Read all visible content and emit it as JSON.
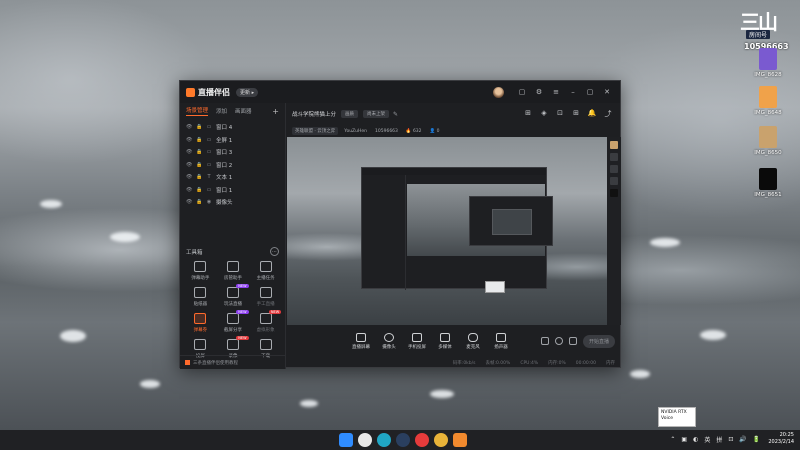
{
  "desktop": {
    "brand": {
      "logo_text": "三山",
      "tag": "房间号",
      "room_number": "10596663"
    },
    "icons": [
      {
        "label": "IMG_8628",
        "color": "#7a5ad0"
      },
      {
        "label": "IMG_8648",
        "color": "#f0a24a"
      },
      {
        "label": "IMG_8650",
        "color": "#c9a26d"
      },
      {
        "label": "IMG_8651",
        "color": "#0a0a0a"
      }
    ]
  },
  "app": {
    "name": "直播伴侣",
    "version_pill": "更新 ▸",
    "left_tabs": [
      {
        "label": "场景管理",
        "active": true
      },
      {
        "label": "添加",
        "active": false
      },
      {
        "label": "画面器",
        "active": false
      }
    ],
    "tab_add": "+",
    "scenes": [
      {
        "icon": "▭",
        "label": "窗口 4"
      },
      {
        "icon": "▭",
        "label": "全屏 1"
      },
      {
        "icon": "▭",
        "label": "窗口 3"
      },
      {
        "icon": "▭",
        "label": "窗口 2"
      },
      {
        "icon": "T",
        "label": "文本 1"
      },
      {
        "icon": "▭",
        "label": "窗口 1"
      },
      {
        "icon": "◉",
        "label": "摄像头"
      }
    ],
    "tools_title": "工具箱",
    "tools_more": "⋯",
    "tools": [
      {
        "label": "弹幕助手",
        "badge": "",
        "orange": false,
        "dim": false
      },
      {
        "label": "房管助手",
        "badge": "",
        "orange": false,
        "dim": false
      },
      {
        "label": "主播任务",
        "badge": "",
        "orange": false,
        "dim": false
      },
      {
        "label": "贴纸器",
        "badge": "",
        "orange": false,
        "dim": false
      },
      {
        "label": "玩法直播",
        "badge": "NEW",
        "orange": false,
        "dim": false
      },
      {
        "label": "手工直播",
        "badge": "",
        "orange": false,
        "dim": true
      },
      {
        "label": "弹幕券",
        "badge": "",
        "orange": true,
        "dim": false
      },
      {
        "label": "截屏分享",
        "badge": "NEW",
        "orange": false,
        "dim": false
      },
      {
        "label": "虚拟形象",
        "badge": "NEW",
        "orange": false,
        "dim": true
      },
      {
        "label": "投屏",
        "badge": "",
        "orange": false,
        "dim": false
      },
      {
        "label": "录像",
        "badge": "NEW",
        "orange": false,
        "dim": false
      },
      {
        "label": "下载",
        "badge": "",
        "orange": false,
        "dim": false
      }
    ],
    "left_footer": "三条直播伴侣使用教程",
    "room": {
      "title": "战斗学院熊猫上分",
      "chip1": "画质",
      "chip2": "尚未上架",
      "edit_icon": "✎"
    },
    "stream_info": {
      "category_chip": "英雄联盟 · 云顶之弈",
      "host": "YouZuHen",
      "room_id": "10596663",
      "hot": "🔥 632",
      "online": "👤 0"
    },
    "top_icons": [
      "⊞",
      "◈",
      "⊡",
      "⊞",
      "🔔",
      "⤴"
    ],
    "controls": [
      {
        "label": "直播屏幕"
      },
      {
        "label": "摄像头"
      },
      {
        "label": "手机投屏"
      },
      {
        "label": "多媒体"
      },
      {
        "label": "麦克风"
      },
      {
        "label": "扬声器"
      }
    ],
    "start_live": "开始直播",
    "status": [
      "码率:0kb/s",
      "丢帧:0.00%",
      "CPU:4%",
      "内存:0%",
      "00:00:00",
      "内存"
    ]
  },
  "taskbar": {
    "apps": [
      {
        "name": "windows",
        "color": "#2f8cff"
      },
      {
        "name": "search",
        "color": "#e8e8e8"
      },
      {
        "name": "edge",
        "color": "#20a6c4"
      },
      {
        "name": "steam",
        "color": "#2a3f5f"
      },
      {
        "name": "netease",
        "color": "#e63b3b"
      },
      {
        "name": "chrome",
        "color": "#e8b339"
      },
      {
        "name": "app-orange",
        "color": "#f28a2e"
      }
    ],
    "tray_items": [
      "⌃",
      "▣",
      "◐",
      "英",
      "拼",
      "⊡",
      "🔊",
      "🔋"
    ],
    "time": "20:25",
    "date": "2023/2/14",
    "tooltip_line1": "NVIDIA RTX",
    "tooltip_line2": "Voice"
  }
}
